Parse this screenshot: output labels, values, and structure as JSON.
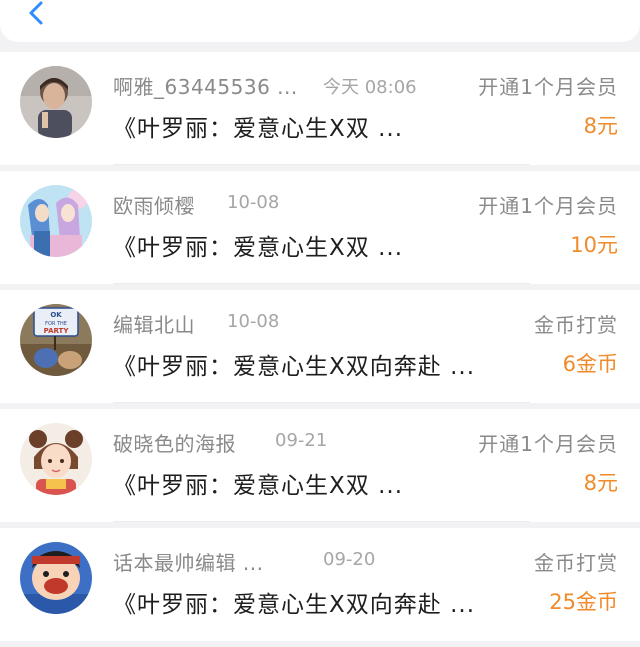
{
  "header": {
    "back_icon": "chevron-left-icon",
    "accent": "#2f8cff"
  },
  "items": [
    {
      "name": "啊雅_63445536 ...",
      "time": "今天 08:06",
      "title": "《叶罗丽：爱意心生X双 ...",
      "type": "开通1个月会员",
      "amount": "8元"
    },
    {
      "name": "欧雨倾樱",
      "time": "10-08",
      "title": "《叶罗丽：爱意心生X双 ...",
      "type": "开通1个月会员",
      "amount": "10元"
    },
    {
      "name": "编辑北山",
      "time": "10-08",
      "title": "《叶罗丽：爱意心生X双向奔赴 ...",
      "type": "金币打赏",
      "amount": "6金币",
      "avatar_text": [
        "OK",
        "FOR THE",
        "PARTY"
      ]
    },
    {
      "name": "破晓色的海报",
      "time": "09-21",
      "title": "《叶罗丽：爱意心生X双 ...",
      "type": "开通1个月会员",
      "amount": "8元"
    },
    {
      "name": "话本最帅编辑 ...",
      "time": "09-20",
      "title": "《叶罗丽：爱意心生X双向奔赴 ...",
      "type": "金币打赏",
      "amount": "25金币"
    }
  ],
  "colors": {
    "amount": "#f08a2a",
    "secondary_text": "#8a8a8a",
    "primary_text": "#1e1e1e"
  }
}
